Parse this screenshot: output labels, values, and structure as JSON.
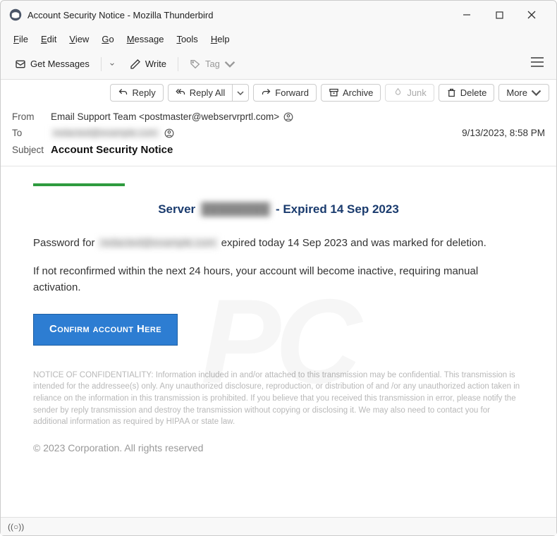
{
  "window": {
    "title": "Account Security Notice - Mozilla Thunderbird"
  },
  "menu": {
    "file": "File",
    "edit": "Edit",
    "view": "View",
    "go": "Go",
    "message": "Message",
    "tools": "Tools",
    "help": "Help"
  },
  "toolbar": {
    "get_messages": "Get Messages",
    "write": "Write",
    "tag": "Tag"
  },
  "msgtoolbar": {
    "reply": "Reply",
    "reply_all": "Reply All",
    "forward": "Forward",
    "archive": "Archive",
    "junk": "Junk",
    "delete": "Delete",
    "more": "More"
  },
  "headers": {
    "from_label": "From",
    "from_value": "Email Support Team <postmaster@webservrprtl.com>",
    "to_label": "To",
    "to_value": "redacted@example.com",
    "datetime": "9/13/2023, 8:58 PM",
    "subject_label": "Subject",
    "subject_value": "Account Security Notice"
  },
  "body": {
    "title_prefix": "Server ",
    "title_redacted": "████████",
    "title_suffix": " - Expired 14 Sep 2023",
    "p1_prefix": "Password for ",
    "p1_redacted": "redacted@example.com",
    "p1_suffix": " expired today 14 Sep 2023 and was marked for deletion.",
    "p2": "If not reconfirmed within the next 24 hours, your account will become inactive, requiring manual activation.",
    "confirm_button": "Confirm account Here",
    "confidentiality": "NOTICE OF CONFIDENTIALITY: Information included in and/or attached to this transmission may be confidential. This transmission is intended for the addressee(s) only. Any unauthorized disclosure, reproduction, or distribution of and /or any unauthorized action taken in reliance on the information in this transmission is prohibited. If you believe that you received this transmission in error, please notify the sender by reply transmission and destroy the transmission without copying or disclosing it. We may also need to contact you for additional information as required by HIPAA or state law.",
    "footer": "© 2023  Corporation. All rights reserved"
  },
  "watermark": "PC"
}
